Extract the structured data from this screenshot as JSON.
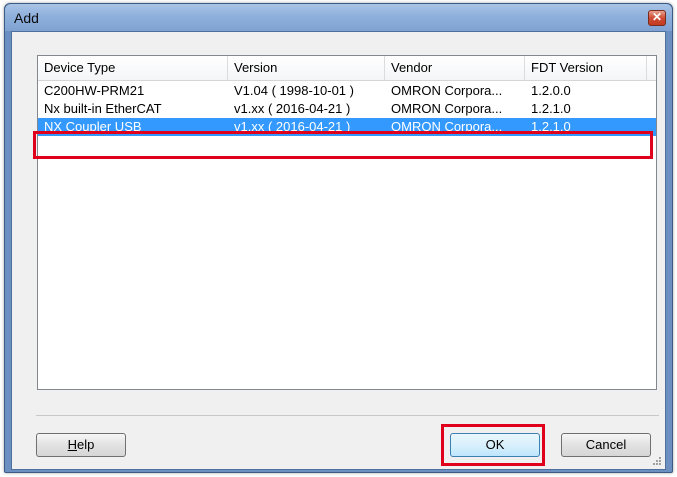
{
  "window": {
    "title": "Add",
    "close_glyph": "✕"
  },
  "list": {
    "columns": [
      "Device Type",
      "Version",
      "Vendor",
      "FDT Version"
    ],
    "rows": [
      {
        "device_type": "C200HW-PRM21",
        "version": "V1.04 ( 1998-10-01 )",
        "vendor": "OMRON Corpora...",
        "fdt_version": "1.2.0.0"
      },
      {
        "device_type": "Nx built-in EtherCAT",
        "version": "v1.xx ( 2016-04-21 )",
        "vendor": "OMRON Corpora...",
        "fdt_version": "1.2.1.0"
      },
      {
        "device_type": "NX Coupler USB",
        "version": "v1.xx ( 2016-04-21 )",
        "vendor": "OMRON Corpora...",
        "fdt_version": "1.2.1.0"
      }
    ],
    "selected_row": 3
  },
  "buttons": {
    "help": {
      "mnemonic": "H",
      "rest": "elp"
    },
    "ok": "OK",
    "cancel": "Cancel"
  },
  "colors": {
    "selection": "#3399ff",
    "highlight": "#e0001b",
    "titlebar": "#8fb0dc"
  }
}
